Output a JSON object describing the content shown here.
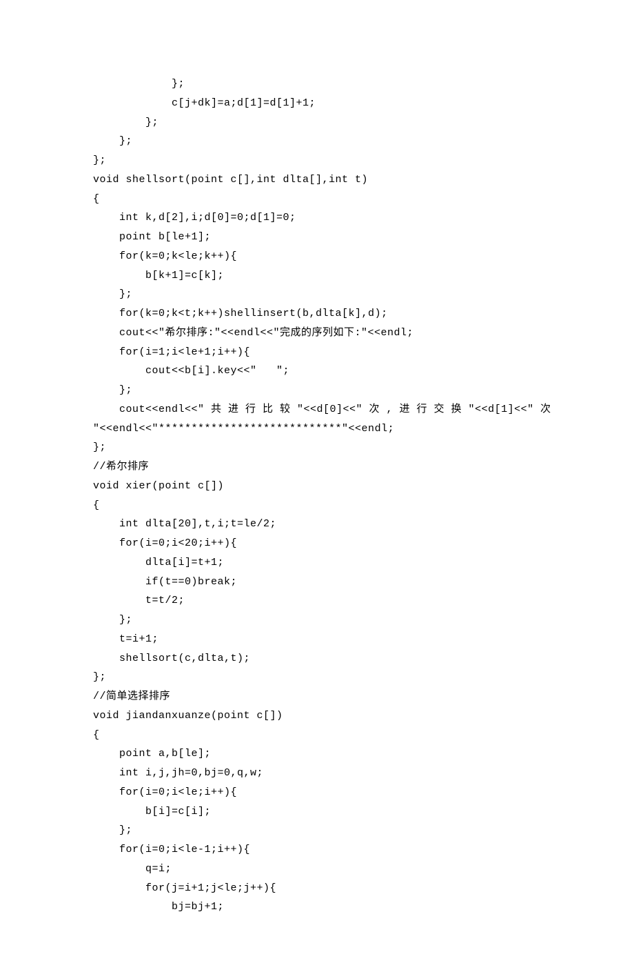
{
  "code_lines": [
    "            };",
    "            c[j+dk]=a;d[1]=d[1]+1;",
    "        };",
    "    };",
    "};",
    "void shellsort(point c[],int dlta[],int t)",
    "{",
    "    int k,d[2],i;d[0]=0;d[1]=0;",
    "    point b[le+1];",
    "    for(k=0;k<le;k++){",
    "        b[k+1]=c[k];",
    "    };",
    "    for(k=0;k<t;k++)shellinsert(b,dlta[k],d);",
    "    cout<<\"希尔排序:\"<<endl<<\"完成的序列如下:\"<<endl;",
    "    for(i=1;i<le+1;i++){",
    "        cout<<b[i].key<<\"   \";",
    "    };",
    "    cout<<endl<<\" 共 进 行 比 较 \"<<d[0]<<\" 次 , 进 行 交 换 \"<<d[1]<<\" 次",
    "\"<<endl<<\"****************************\"<<endl;",
    "};",
    "//希尔排序",
    "void xier(point c[])",
    "{",
    "    int dlta[20],t,i;t=le/2;",
    "    for(i=0;i<20;i++){",
    "        dlta[i]=t+1;",
    "        if(t==0)break;",
    "        t=t/2;",
    "    };",
    "    t=i+1;",
    "    shellsort(c,dlta,t);",
    "};",
    "//简单选择排序",
    "void jiandanxuanze(point c[])",
    "{",
    "    point a,b[le];",
    "    int i,j,jh=0,bj=0,q,w;",
    "    for(i=0;i<le;i++){",
    "        b[i]=c[i];",
    "    };",
    "    for(i=0;i<le-1;i++){",
    "        q=i;",
    "        for(j=i+1;j<le;j++){",
    "            bj=bj+1;"
  ]
}
